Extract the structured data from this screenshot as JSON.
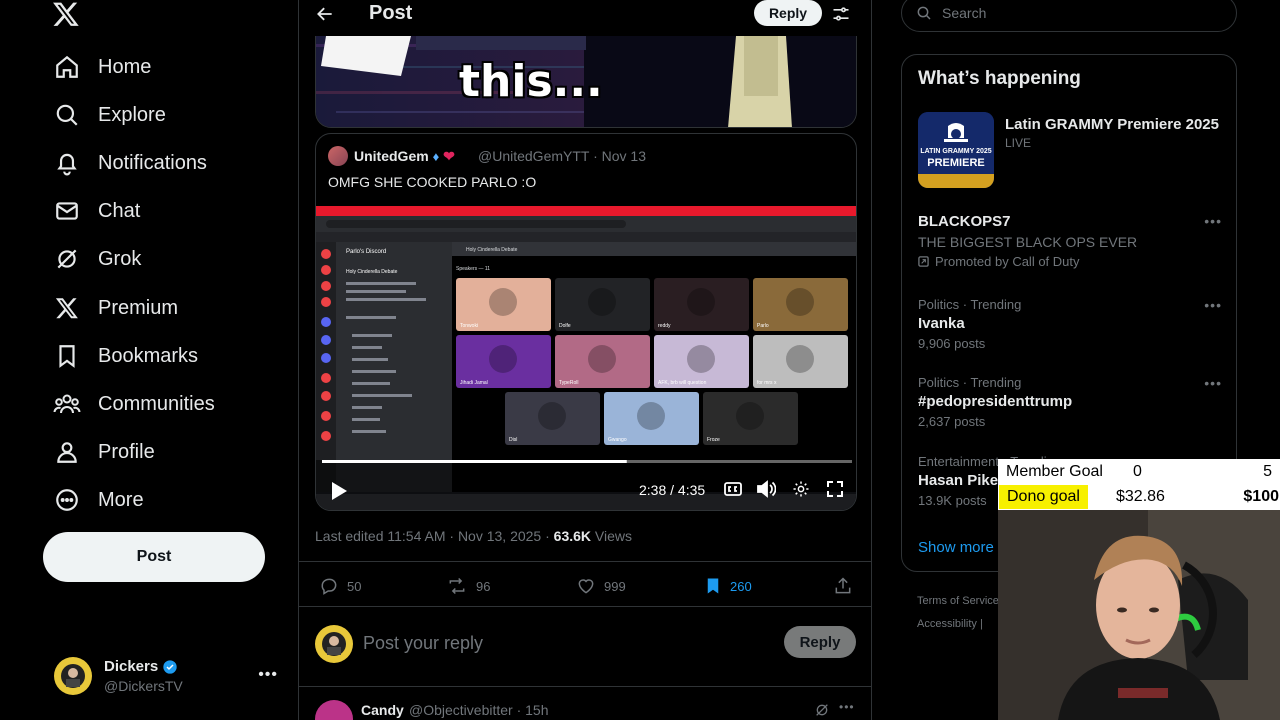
{
  "nav": {
    "items": [
      {
        "label": "Home",
        "icon": "home-icon"
      },
      {
        "label": "Explore",
        "icon": "search-icon"
      },
      {
        "label": "Notifications",
        "icon": "bell-icon"
      },
      {
        "label": "Chat",
        "icon": "mail-icon"
      },
      {
        "label": "Grok",
        "icon": "grok-icon"
      },
      {
        "label": "Premium",
        "icon": "x-icon"
      },
      {
        "label": "Bookmarks",
        "icon": "bookmark-icon"
      },
      {
        "label": "Communities",
        "icon": "people-icon"
      },
      {
        "label": "Profile",
        "icon": "person-icon"
      },
      {
        "label": "More",
        "icon": "more-circle-icon"
      }
    ],
    "post_label": "Post"
  },
  "account": {
    "name": "Dickers",
    "handle": "@DickersTV"
  },
  "header": {
    "title": "Post",
    "reply_label": "Reply"
  },
  "media_top": {
    "caption": "this..."
  },
  "quote": {
    "name": "UnitedGem",
    "handle_date": "@UnitedGemYTT · Nov 13",
    "text": "OMFG SHE COOKED PARLO :O",
    "video": {
      "time": "2:38 / 4:35",
      "progress": 0.575,
      "discord": {
        "server": "Parlo's Discord",
        "channel": "Holy Cinderella Debate",
        "speakers": "Speakers — 11",
        "tiles": [
          "Tonwoki",
          "Dolfe",
          "reddy",
          "Parlo",
          "Jihadi Jamal",
          "TypeRoll",
          "AFK, brb will question",
          "for mrs x",
          "Disl",
          "Gwango",
          "Froze"
        ]
      }
    }
  },
  "meta": {
    "edited": "Last edited 11:54 AM · Nov 13, 2025 · ",
    "views_count": "63.6K",
    "views_label": " Views"
  },
  "actions": {
    "replies": "50",
    "reposts": "96",
    "likes": "999",
    "bookmarks": "260"
  },
  "reply_box": {
    "placeholder": "Post your reply",
    "button": "Reply"
  },
  "next_post": {
    "name": "Candy",
    "handle_time": "@Objectivebitter · 15h"
  },
  "search": {
    "placeholder": "Search"
  },
  "happening": {
    "title": "What’s happening",
    "event": {
      "title": "Latin GRAMMY Premiere 2025",
      "status": "LIVE",
      "image_text_1": "LATIN GRAMMY 2025",
      "image_text_2": "PREMIERE"
    },
    "promoted": {
      "title": "BLACKOPS7",
      "subtitle": "THE BIGGEST BLACK OPS EVER",
      "by": "Promoted by Call of Duty"
    },
    "trends": [
      {
        "context": "Politics · Trending",
        "title": "Ivanka",
        "count": "9,906 posts"
      },
      {
        "context": "Politics · Trending",
        "title": "#pedopresidenttrump",
        "count": "2,637 posts"
      },
      {
        "context": "Entertainment · Trending",
        "title": "Hasan Piker",
        "count": "13.9K posts"
      }
    ],
    "show_more": "Show more"
  },
  "footer": {
    "terms": "Terms of Service",
    "accessibility": "Accessibility |"
  },
  "overlay": {
    "member_goal_label": "Member Goal",
    "member_goal_current": "0",
    "member_goal_target": "5",
    "dono_goal_label": "Dono goal",
    "dono_goal_current": "$32.86",
    "dono_goal_target": "$100",
    "dono_color": "#f7f000"
  },
  "colors": {
    "accent": "#1d9bf0",
    "background": "#000000",
    "border": "#2f3336",
    "muted": "#71767b"
  }
}
